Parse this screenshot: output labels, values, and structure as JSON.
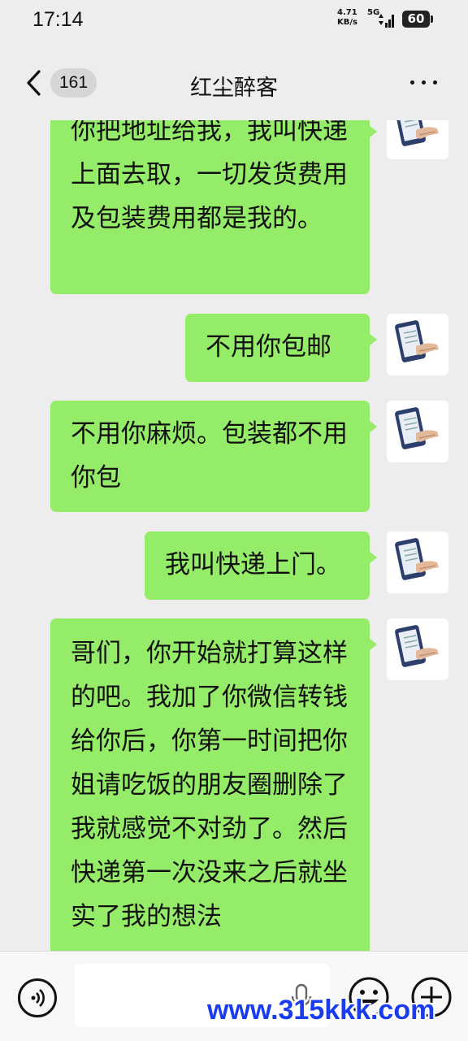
{
  "status_bar": {
    "time": "17:14",
    "net_speed": [
      "4.71",
      "KB/s"
    ],
    "net_type": "5G",
    "battery": "60",
    "icons": [
      "signal-icon",
      "battery-icon"
    ]
  },
  "nav": {
    "unread_count": "161",
    "title": "红尘醉客",
    "icons": [
      "chevron-left-icon",
      "more-icon"
    ]
  },
  "messages": [
    {
      "sender": "self",
      "text": "你把地址给我，我叫快递上面去取，一切发货费用及包装费用都是我的。"
    },
    {
      "sender": "self",
      "text": "不用你包邮"
    },
    {
      "sender": "self",
      "text": "不用你麻烦。包装都不用你包"
    },
    {
      "sender": "self",
      "text": "我叫快递上门。"
    },
    {
      "sender": "self",
      "text": "哥们，你开始就打算这样的吧。我加了你微信转钱给你后，你第一时间把你姐请吃饭的朋友圈删除了我就感觉不对劲了。然后快递第一次没来之后就坐实了我的想法"
    }
  ],
  "input_bar": {
    "placeholder": "",
    "icons": [
      "voice-icon",
      "mic-icon",
      "emoji-icon",
      "plus-icon"
    ]
  },
  "watermark": "www.315kkk.com",
  "colors": {
    "bubble": "#95ec69",
    "background": "#ededed"
  }
}
